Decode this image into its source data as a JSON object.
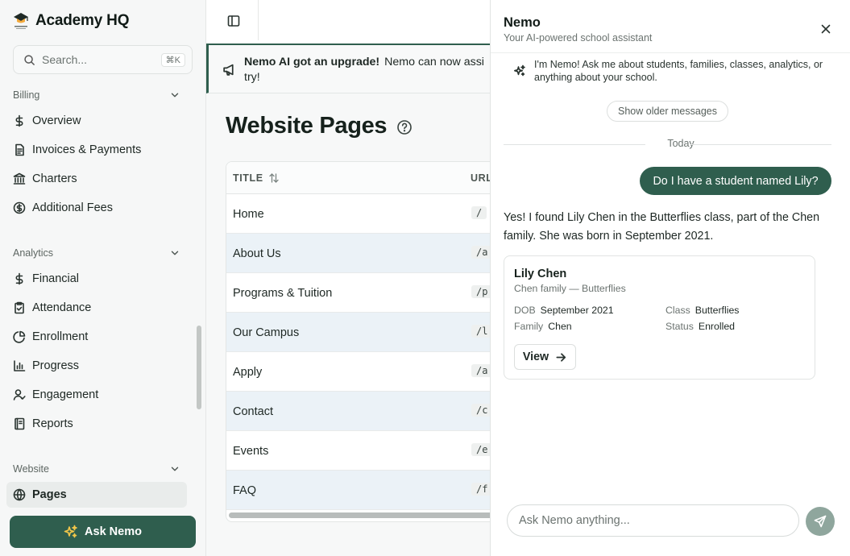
{
  "sidebar": {
    "brand": "Academy HQ",
    "search": {
      "placeholder": "Search...",
      "shortcut": "⌘K"
    },
    "sections": [
      {
        "title": "Billing",
        "items": [
          {
            "label": "Overview",
            "icon": "dollar-icon"
          },
          {
            "label": "Invoices & Payments",
            "icon": "document-icon"
          },
          {
            "label": "Charters",
            "icon": "bank-icon"
          },
          {
            "label": "Additional Fees",
            "icon": "dollar-circle-icon"
          }
        ]
      },
      {
        "title": "Analytics",
        "items": [
          {
            "label": "Financial",
            "icon": "dollar-icon"
          },
          {
            "label": "Attendance",
            "icon": "clipboard-check-icon"
          },
          {
            "label": "Enrollment",
            "icon": "pie-chart-icon"
          },
          {
            "label": "Progress",
            "icon": "bar-chart-icon"
          },
          {
            "label": "Engagement",
            "icon": "user-check-icon"
          },
          {
            "label": "Reports",
            "icon": "notebook-icon"
          }
        ]
      },
      {
        "title": "Website",
        "items": [
          {
            "label": "Pages",
            "icon": "globe-icon",
            "active": true
          }
        ]
      }
    ],
    "ask_button": "Ask Nemo"
  },
  "main": {
    "banner": {
      "title": "Nemo AI got an upgrade!",
      "text": "Nemo can now assi",
      "text2": "try!"
    },
    "page_title": "Website Pages",
    "table": {
      "columns": [
        "TITLE",
        "URL"
      ],
      "rows": [
        {
          "title": "Home",
          "url": "/"
        },
        {
          "title": "About Us",
          "url": "/a"
        },
        {
          "title": "Programs & Tuition",
          "url": "/p"
        },
        {
          "title": "Our Campus",
          "url": "/l"
        },
        {
          "title": "Apply",
          "url": "/a"
        },
        {
          "title": "Contact",
          "url": "/c"
        },
        {
          "title": "Events",
          "url": "/e"
        },
        {
          "title": "FAQ",
          "url": "/f"
        }
      ]
    }
  },
  "chat": {
    "title": "Nemo",
    "subtitle": "Your AI-powered school assistant",
    "intro": "I'm Nemo! Ask me about students, families, classes, analytics, or anything about your school.",
    "older_button": "Show older messages",
    "divider": "Today",
    "user_message": "Do I have a student named Lily?",
    "ai_message": "Yes! I found Lily Chen in the Butterflies class, part of the Chen family. She was born in September 2021.",
    "card": {
      "name": "Lily Chen",
      "subtitle": "Chen family — Butterflies",
      "fields": [
        {
          "key": "DOB",
          "value": "September 2021"
        },
        {
          "key": "Class",
          "value": "Butterflies"
        },
        {
          "key": "Family",
          "value": "Chen"
        },
        {
          "key": "Status",
          "value": "Enrolled"
        }
      ],
      "button": "View"
    },
    "input_placeholder": "Ask Nemo anything..."
  },
  "colors": {
    "brand": "#2f5e4e",
    "accent": "#f2c64a",
    "row_alt": "#ebf2f7"
  }
}
